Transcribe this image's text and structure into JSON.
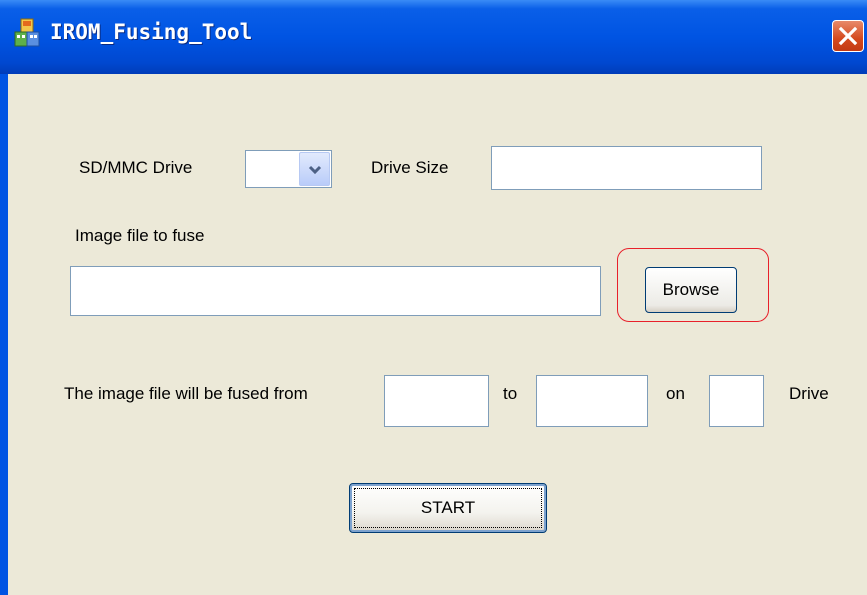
{
  "window": {
    "title": "IROM_Fusing_Tool",
    "icon": "app-icon",
    "close_icon": "close-icon",
    "colors": {
      "titlebar": "#0054E3",
      "background": "#ECE9D8",
      "close": "#D4491E",
      "highlight": "#E8202A"
    }
  },
  "drive": {
    "sd_label": "SD/MMC Drive",
    "sd_value": "",
    "size_label": "Drive Size",
    "size_value": ""
  },
  "image": {
    "label": "Image file to fuse",
    "path_value": "",
    "browse_label": "Browse"
  },
  "range": {
    "prefix_label": "The image file will be fused from",
    "from_value": "",
    "to_label": "to",
    "to_value": "",
    "on_label": "on",
    "drive_value": "",
    "drive_label": "Drive"
  },
  "actions": {
    "start_label": "START"
  }
}
